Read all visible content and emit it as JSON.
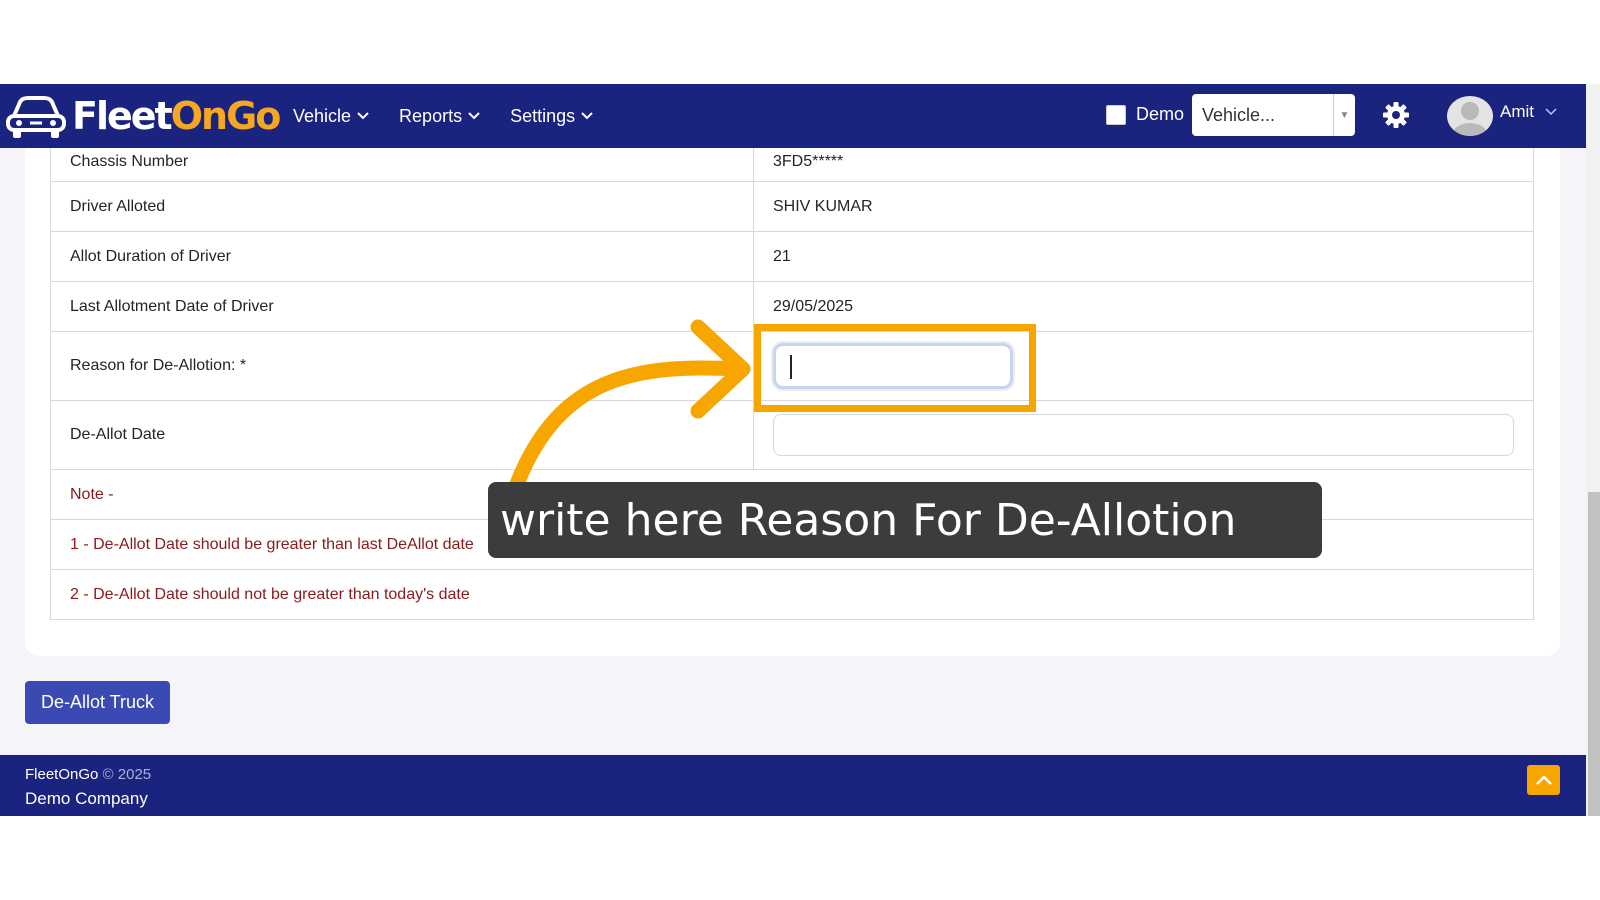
{
  "navbar": {
    "brand_part1": "Fleet",
    "brand_part2": "On",
    "brand_part3": "Go",
    "menu": [
      {
        "label": "Vehicle"
      },
      {
        "label": "Reports"
      },
      {
        "label": "Settings"
      }
    ],
    "demo_label": "Demo",
    "demo_checked": false,
    "vehicle_select": "Vehicle...",
    "user_name": "Amit",
    "colors": {
      "background": "#1a237e",
      "accent": "#f5a623"
    }
  },
  "details": {
    "rows": [
      {
        "label": "Chassis Number",
        "value": "3FD5*****"
      },
      {
        "label": "Driver Alloted",
        "value": "SHIV KUMAR"
      },
      {
        "label": "Allot Duration of Driver",
        "value": "21"
      },
      {
        "label": "Last Allotment Date of Driver",
        "value": "29/05/2025"
      }
    ],
    "reason_label": "Reason for De-Allotion: *",
    "reason_value": "",
    "deallot_date_label": "De-Allot Date",
    "deallot_date_value": "",
    "note_title": "Note -",
    "note_1": "1 - De-Allot Date should be greater than last DeAllot date",
    "note_2": "2 - De-Allot Date should not be greater than today's date"
  },
  "tooltip": {
    "text": "write here Reason For De-Allotion",
    "highlight_color": "#f7a600"
  },
  "actions": {
    "deallot_button": "De-Allot Truck"
  },
  "footer": {
    "brand": "FleetOnGo",
    "copyright": "© 2025",
    "company": "Demo Company"
  }
}
